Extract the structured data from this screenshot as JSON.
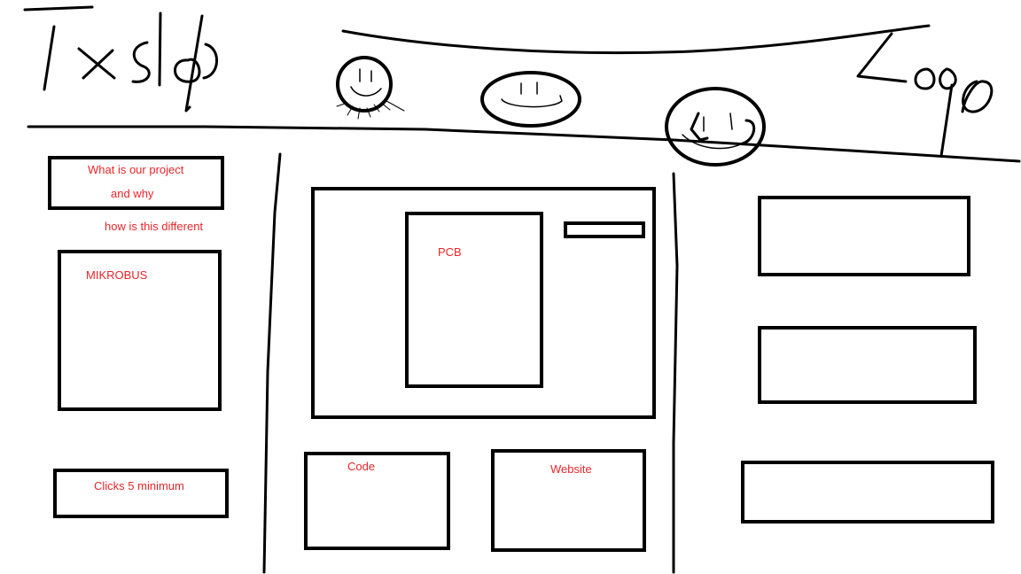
{
  "header": {
    "title": "Txslab",
    "logo": "Logo"
  },
  "nav": {
    "icons": [
      "smiley-icon",
      "face-icon",
      "face-icon"
    ]
  },
  "left": {
    "project_line1": "What is our project",
    "project_line2": "and why",
    "different": "how is this different",
    "mikrobus": "MIKROBUS",
    "clicks": "Clicks 5 minimum"
  },
  "center": {
    "pcb": "PCB",
    "code": "Code",
    "website": "Website"
  }
}
